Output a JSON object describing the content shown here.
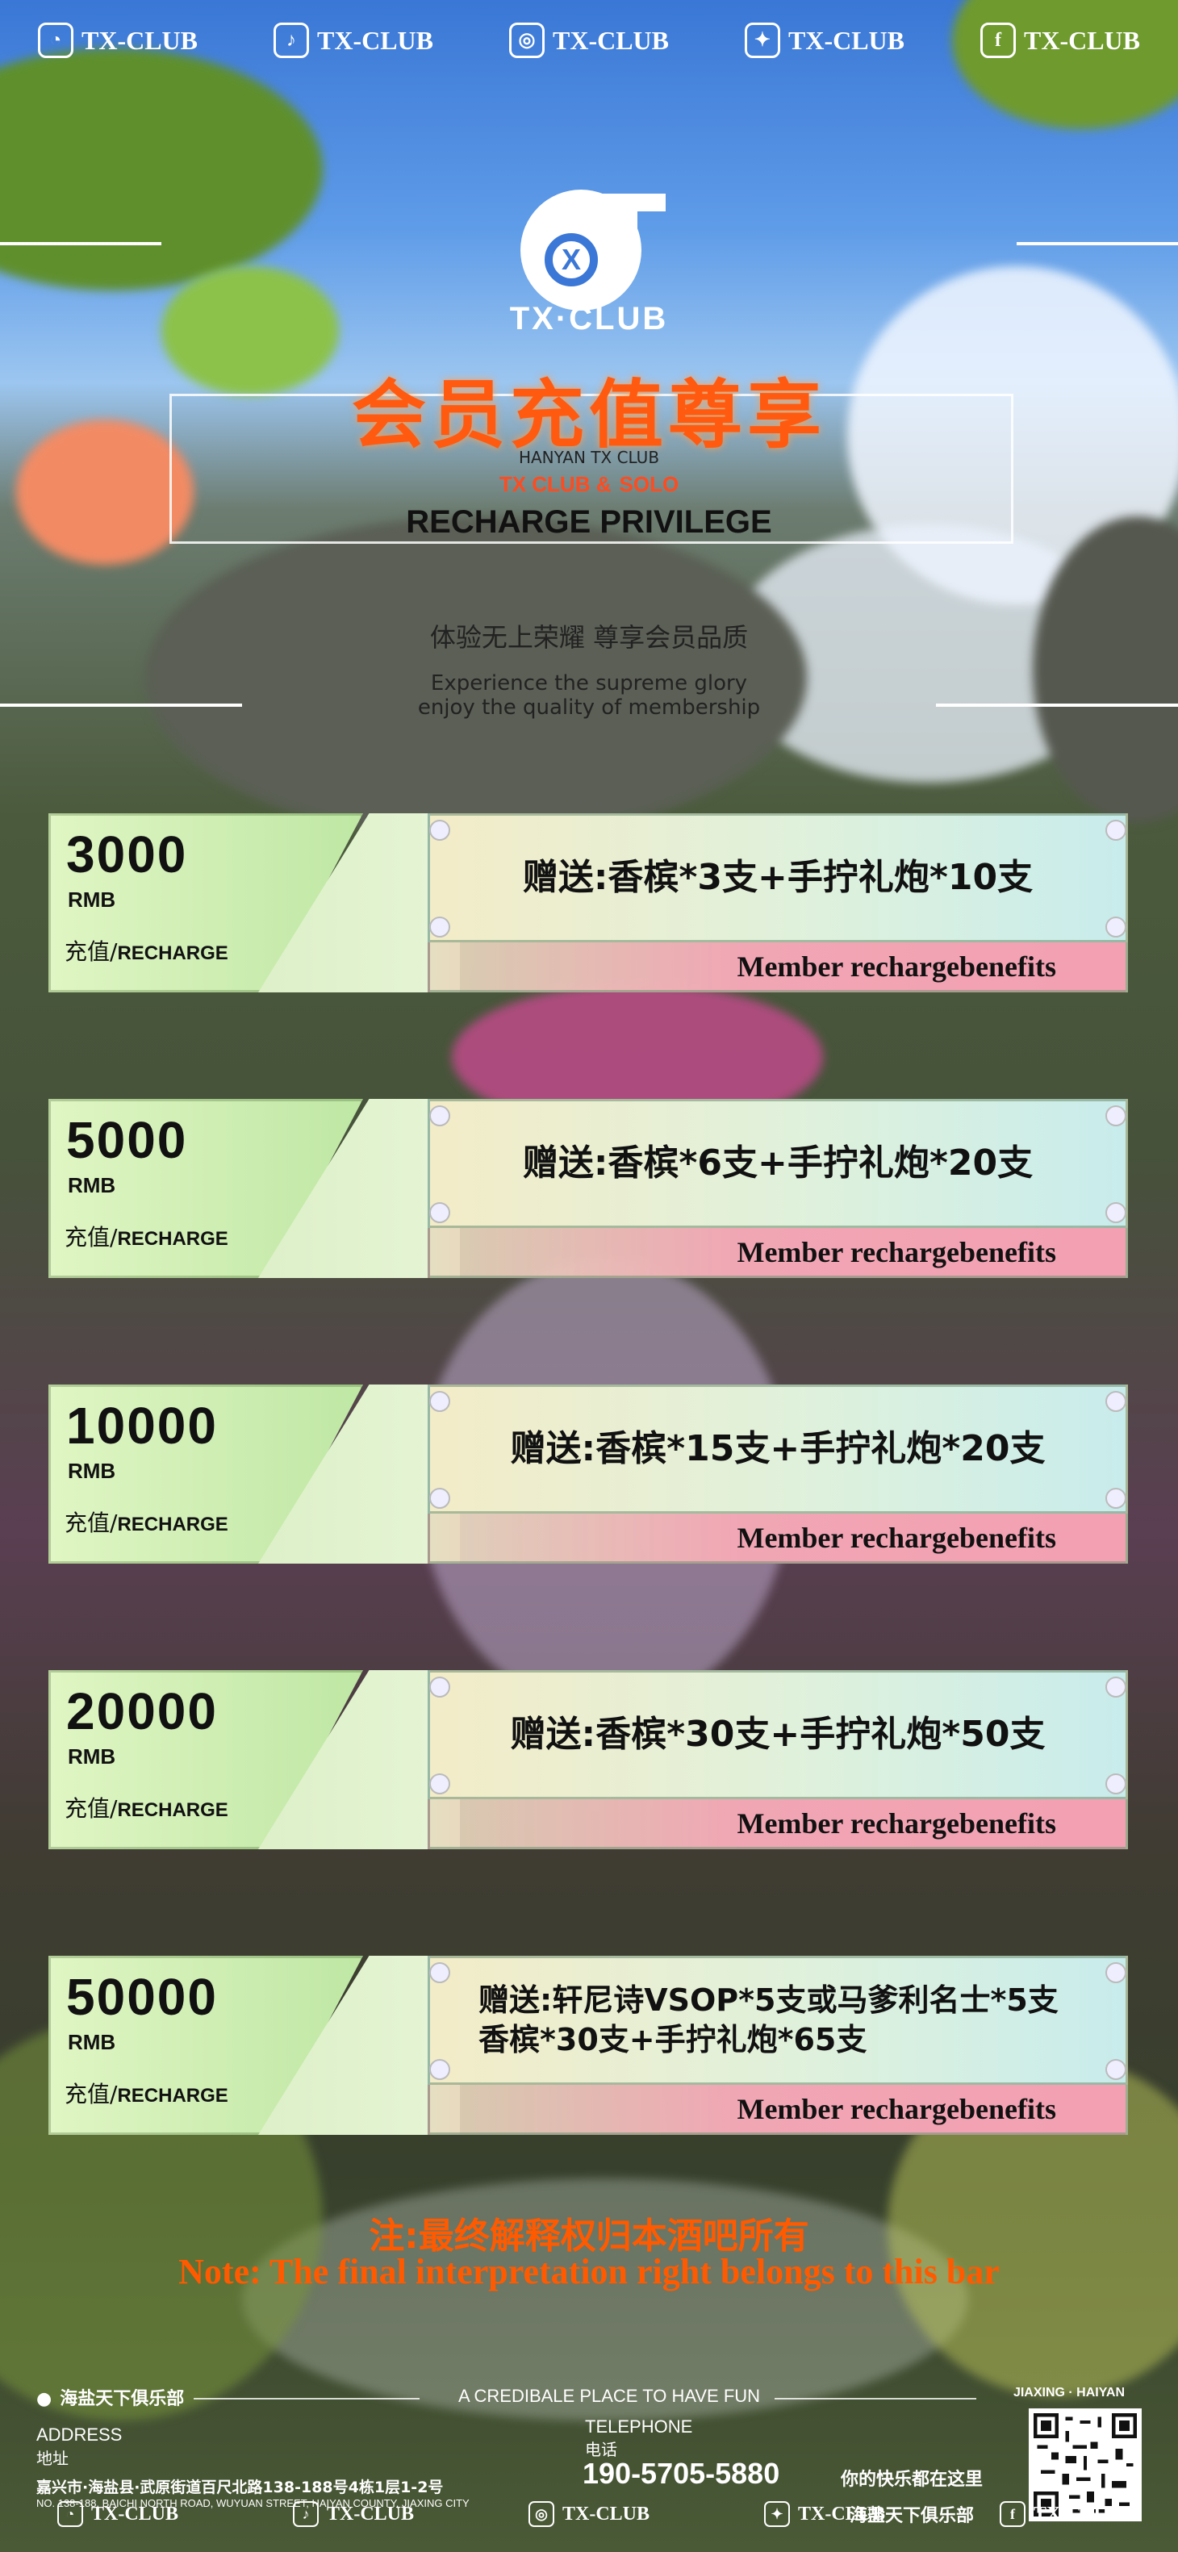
{
  "social_top": [
    {
      "icon": "wechat-icon",
      "glyph": "◔",
      "label": "TX-CLUB"
    },
    {
      "icon": "tiktok-icon",
      "glyph": "♪",
      "label": "TX-CLUB"
    },
    {
      "icon": "instagram-icon",
      "glyph": "◎",
      "label": "TX-CLUB"
    },
    {
      "icon": "twitter-icon",
      "glyph": "✦",
      "label": "TX-CLUB"
    },
    {
      "icon": "facebook-icon",
      "glyph": "f",
      "label": "TX-CLUB"
    }
  ],
  "header": {
    "brand": "TX·CLUB",
    "title_cn": "会员充值尊享",
    "subtitle_en": "HANYAN TX CLUB",
    "co_brand_a": "TX CLUB &",
    "co_brand_b": "SOLO",
    "recharge_title": "RECHARGE PRIVILEGE",
    "tagline_cn": "体验无上荣耀 尊享会员品质",
    "tagline_en_1": "Experience the supreme glory",
    "tagline_en_2": "enjoy the quality of membership"
  },
  "tiers": [
    {
      "amount": "3000",
      "unit": "RMB",
      "recharge_cn": "充值/",
      "recharge_en": "RECHARGE",
      "benefit": "赠送:香槟*3支+手拧礼炮*10支",
      "strip": "Member rechargebenefits"
    },
    {
      "amount": "5000",
      "unit": "RMB",
      "recharge_cn": "充值/",
      "recharge_en": "RECHARGE",
      "benefit": "赠送:香槟*6支+手拧礼炮*20支",
      "strip": "Member rechargebenefits"
    },
    {
      "amount": "10000",
      "unit": "RMB",
      "recharge_cn": "充值/",
      "recharge_en": "RECHARGE",
      "benefit": "赠送:香槟*15支+手拧礼炮*20支",
      "strip": "Member rechargebenefits"
    },
    {
      "amount": "20000",
      "unit": "RMB",
      "recharge_cn": "充值/",
      "recharge_en": "RECHARGE",
      "benefit": "赠送:香槟*30支+手拧礼炮*50支",
      "strip": "Member rechargebenefits"
    },
    {
      "amount": "50000",
      "unit": "RMB",
      "recharge_cn": "充值/",
      "recharge_en": "RECHARGE",
      "benefit_line1": "赠送:轩尼诗VSOP*5支或马爹利名士*5支",
      "benefit_line2": "香槟*30支+手拧礼炮*65支",
      "strip": "Member rechargebenefits"
    }
  ],
  "note": {
    "cn": "注:最终解释权归本酒吧所有",
    "en": "Note: The final interpretation right belongs to this bar"
  },
  "footer": {
    "club_name": "海盐天下俱乐部",
    "slogan": "A CREDIBALE PLACE TO HAVE FUN",
    "location": "JIAXING · HAIYAN",
    "address_label": "ADDRESS",
    "address_label_cn": "地址",
    "address_cn": "嘉兴市·海盐县·武原街道百尺北路138-188号4栋1层1-2号",
    "address_en": "NO. 138-188, BAICHI NORTH ROAD, WUYUAN STREET, HAIYAN COUNTY, JIAXING CITY",
    "telephone_label": "TELEPHONE",
    "telephone_label_cn": "电话",
    "phone": "190-5705-5880",
    "fun_line_1": "你的快乐都在这里",
    "fun_line_2": "海盐天下俱乐部"
  },
  "social_bottom": [
    {
      "icon": "wechat-icon",
      "glyph": "◔",
      "label": "TX-CLUB"
    },
    {
      "icon": "tiktok-icon",
      "glyph": "♪",
      "label": "TX-CLUB"
    },
    {
      "icon": "instagram-icon",
      "glyph": "◎",
      "label": "TX-CLUB"
    },
    {
      "icon": "twitter-icon",
      "glyph": "✦",
      "label": "TX-CLUB"
    },
    {
      "icon": "facebook-icon",
      "glyph": "f",
      "label": "TX-CLUB"
    }
  ],
  "colors": {
    "accent_orange": "#ff5a10",
    "panel_green": "#bfe7a4",
    "strip_pink": "#f3a0b2",
    "sky_blue": "#3a77d6"
  }
}
